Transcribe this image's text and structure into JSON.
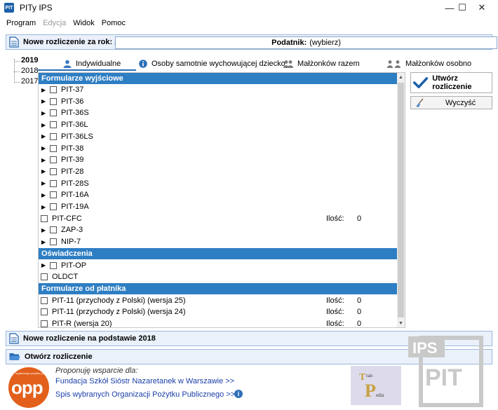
{
  "window": {
    "title": "PITy IPS",
    "minimize": "—",
    "maximize": "☐",
    "close": "✕"
  },
  "menu": {
    "items": [
      "Program",
      "Edycja",
      "Widok",
      "Pomoc"
    ]
  },
  "new_return": {
    "label": "Nowe rozliczenie za rok: 2019",
    "taxpayer_label": "Podatnik:",
    "taxpayer_value": "(wybierz)"
  },
  "years": [
    "2019",
    "2018",
    "2017"
  ],
  "tabs": [
    "Indywidualne",
    "Osoby samotnie wychowującej dziecko",
    "Małżonków razem",
    "Małżonków osobno"
  ],
  "groups": {
    "outgoing": "Formularze wyjściowe",
    "statements": "Oświadczenia",
    "payer": "Formularze od płatnika"
  },
  "outgoing_forms": [
    "PIT-37",
    "PIT-36",
    "PIT-36S",
    "PIT-36L",
    "PIT-36LS",
    "PIT-38",
    "PIT-39",
    "PIT-28",
    "PIT-28S",
    "PIT-16A",
    "PIT-19A"
  ],
  "cfc": {
    "label": "PIT-CFC",
    "qty_label": "Ilość:",
    "qty": "0"
  },
  "zap": [
    "ZAP-3",
    "NIP-7"
  ],
  "statements": {
    "op": "PIT-OP",
    "oldct": "OLDCT"
  },
  "payer_forms": [
    {
      "label": "PIT-11 (przychody z Polski) (wersja 25)",
      "qty_label": "Ilość:",
      "qty": "0"
    },
    {
      "label": "PIT-11 (przychody z Polski) (wersja 24)",
      "qty_label": "Ilość:",
      "qty": "0"
    },
    {
      "label": "PIT-R (wersja 20)",
      "qty_label": "Ilość:",
      "qty": "0"
    }
  ],
  "buttons": {
    "create": "Utwórz rozliczenie",
    "clear": "Wyczyść"
  },
  "new_from_prev": {
    "label": "Nowe rozliczenie na podstawie 2018"
  },
  "open_return": {
    "label": "Otwórz rozliczenie"
  },
  "footer": {
    "title": "Proponuję wsparcie dla:",
    "link1": "Fundacja Szkół Sióstr Nazaretanek w Warszawie >>",
    "link2": "Spis wybranych Organizacji Pożytku Publicznego >>",
    "opp_logo_text": "opp",
    "opp_small_text": "organizacja pożytku publicznego"
  },
  "logos": {
    "tp": "Tran Pedia",
    "ips": "IPS",
    "pit": "PIT"
  },
  "colors": {
    "group_header": "#2e7ec3",
    "section_bg": "#eaf1fb",
    "accent": "#1c5fa8",
    "opp": "#e2601c"
  }
}
